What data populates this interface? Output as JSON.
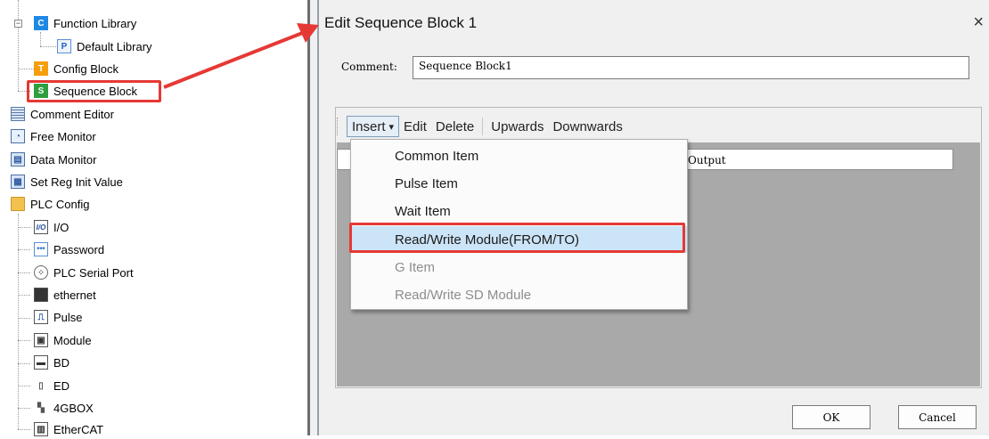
{
  "tree": {
    "items": [
      {
        "label": "Function Library"
      },
      {
        "label": "Default Library"
      },
      {
        "label": "Config Block"
      },
      {
        "label": "Sequence Block"
      },
      {
        "label": "Comment Editor"
      },
      {
        "label": "Free Monitor"
      },
      {
        "label": "Data Monitor"
      },
      {
        "label": "Set Reg Init Value"
      },
      {
        "label": "PLC Config"
      },
      {
        "label": "I/O"
      },
      {
        "label": "Password"
      },
      {
        "label": "PLC Serial Port"
      },
      {
        "label": "ethernet"
      },
      {
        "label": "Pulse"
      },
      {
        "label": "Module"
      },
      {
        "label": "BD"
      },
      {
        "label": "ED"
      },
      {
        "label": "4GBOX"
      },
      {
        "label": "EtherCAT"
      }
    ],
    "icons": {
      "function_library": "C",
      "default_library": "P",
      "config_block": "T",
      "sequence_block": "S",
      "io": "I/O"
    }
  },
  "dialog": {
    "title": "Edit Sequence Block 1",
    "close_glyph": "×",
    "comment_label": "Comment:",
    "comment_value": "Sequence Block1",
    "toolbar": {
      "insert": "Insert",
      "insert_arrow": "▾",
      "edit": "Edit",
      "delete": "Delete",
      "upwards": "Upwards",
      "downwards": "Downwards"
    },
    "grid": {
      "column_output": "Output"
    },
    "menu": {
      "items": [
        {
          "label": "Common Item",
          "enabled": true
        },
        {
          "label": "Pulse Item",
          "enabled": true
        },
        {
          "label": "Wait Item",
          "enabled": true
        },
        {
          "label": "Read/Write Module(FROM/TO)",
          "enabled": true,
          "highlighted": true
        },
        {
          "label": "G Item",
          "enabled": false
        },
        {
          "label": "Read/Write SD Module",
          "enabled": false
        }
      ]
    },
    "ok_label": "OK",
    "cancel_label": "Cancel"
  },
  "colors": {
    "annotation_red": "#e53935",
    "menu_highlight": "#cce4f7"
  }
}
